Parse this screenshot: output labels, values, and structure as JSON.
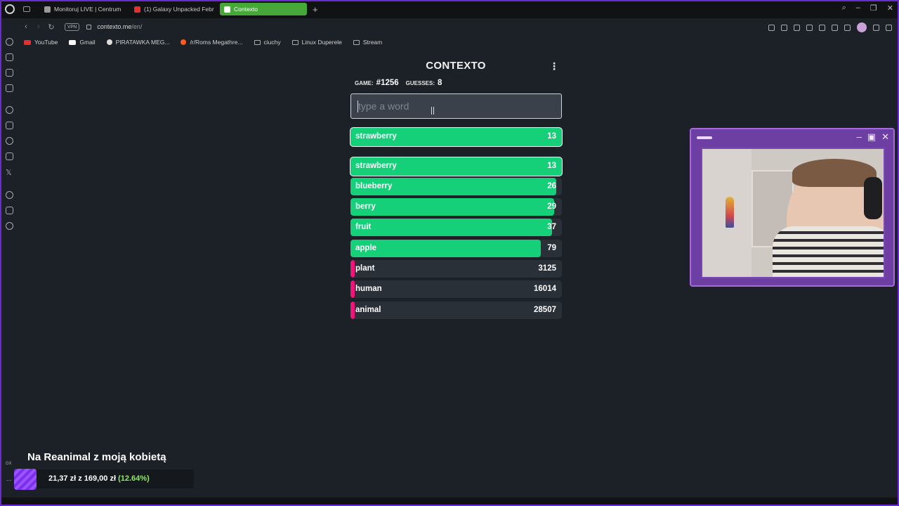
{
  "browser": {
    "tabs": [
      {
        "label": "Monitoruj LIVE | Centrum",
        "color": "#9a9a9a"
      },
      {
        "label": "(1) Galaxy Unpacked Febr",
        "color": "#e23030"
      },
      {
        "label": "Contexto",
        "color": "#ffffff",
        "active": true
      }
    ],
    "url_host": "contexto.me",
    "url_path": "/en/",
    "vpn_label": "VPN",
    "bookmarks": [
      {
        "label": "YouTube",
        "color": "#e23030"
      },
      {
        "label": "Gmail",
        "color": "#ffffff"
      },
      {
        "label": "PIRATAWKA MEG...",
        "color": "#dddddd"
      },
      {
        "label": "/r/Roms Megathre...",
        "color": "#ff5a1f"
      },
      {
        "label": "ciuchy",
        "folder": true
      },
      {
        "label": "Linux Duperele",
        "folder": true
      },
      {
        "label": "Stream",
        "folder": true
      }
    ]
  },
  "game": {
    "title": "CONTEXTO",
    "menu_icon": "kebab-menu-icon",
    "game_label": "GAME:",
    "game_number": "#1256",
    "guesses_label": "GUESSES:",
    "guesses_count": "8",
    "input_placeholder": "type a word",
    "last_guess": {
      "word": "strawberry",
      "distance": "13",
      "fill": 1.0,
      "color": "green"
    },
    "guesses": [
      {
        "word": "strawberry",
        "distance": "13",
        "fill": 1.0,
        "color": "green"
      },
      {
        "word": "blueberry",
        "distance": "26",
        "fill": 0.975,
        "color": "green"
      },
      {
        "word": "berry",
        "distance": "29",
        "fill": 0.965,
        "color": "green"
      },
      {
        "word": "fruit",
        "distance": "37",
        "fill": 0.955,
        "color": "green"
      },
      {
        "word": "apple",
        "distance": "79",
        "fill": 0.9,
        "color": "green"
      },
      {
        "word": "plant",
        "distance": "3125",
        "fill": 0.02,
        "color": "pink"
      },
      {
        "word": "human",
        "distance": "16014",
        "fill": 0.02,
        "color": "pink"
      },
      {
        "word": "animal",
        "distance": "28507",
        "fill": 0.02,
        "color": "pink"
      }
    ],
    "colors": {
      "green": "#16cf79",
      "pink": "#f0137a",
      "background": "#1c2127",
      "row_bg": "#2a3038"
    }
  },
  "overlay": {
    "donation_title": "Na Reanimal z moją kobietą",
    "donation_current": "21,37 zł",
    "donation_sep": "z",
    "donation_goal": "169,00 zł",
    "donation_percent": "(12.64%)",
    "gx_label": "GX",
    "dots_label": "..."
  }
}
